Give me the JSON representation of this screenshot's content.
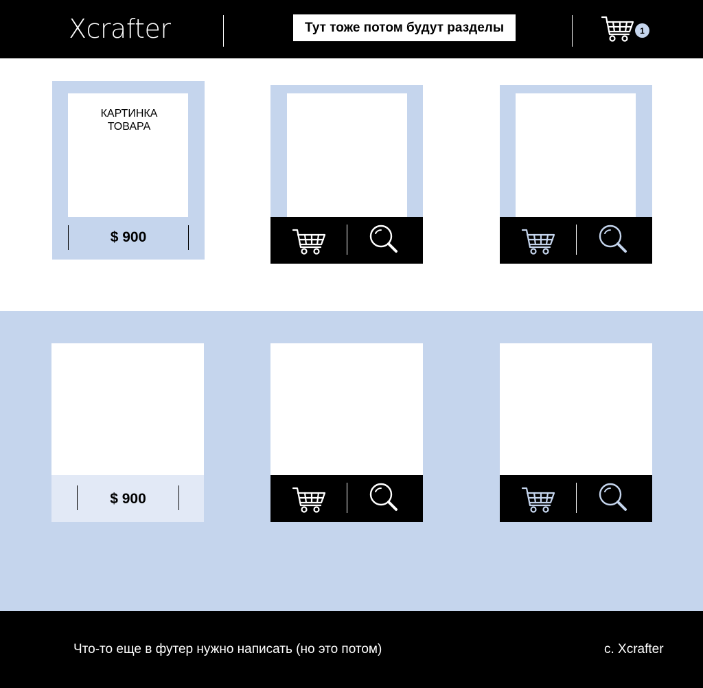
{
  "header": {
    "logo": "Xcrafter",
    "sections_banner": "Тут тоже потом будут разделы",
    "cart_count": "1"
  },
  "products": {
    "image_placeholder": "КАРТИНКА ТОВАРА",
    "price": "$ 900"
  },
  "footer": {
    "note": "Что-то еще в футер нужно написать (но это потом)",
    "copyright": "с. Xcrafter"
  },
  "colors": {
    "accent": "#c5d5ed",
    "accent_light": "#e2e9f6",
    "dark": "#000000",
    "light": "#ffffff"
  },
  "icons": {
    "cart": "cart-icon",
    "search": "search-icon"
  }
}
